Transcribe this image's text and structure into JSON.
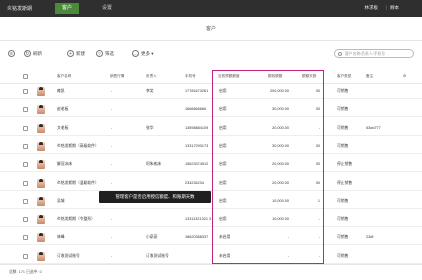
{
  "topbar": {
    "brand": "炎铭发斯期",
    "tabs": [
      {
        "label": "客户",
        "active": true
      },
      {
        "label": "设置",
        "active": false
      }
    ],
    "right_a": "林求板",
    "sep": "|",
    "right_b": "顾本"
  },
  "page": {
    "title": "客户"
  },
  "toolbar": {
    "refresh": "刷新",
    "add": "新建",
    "filter": "筛选",
    "more": "更多",
    "search_placeholder": "客户名称/负责人/手机号"
  },
  "columns": [
    "客户名称",
    "销售行情",
    "负责人",
    "手机号",
    "应收预额额度",
    "额收额额",
    "额额天数",
    "客户类型",
    "备注"
  ],
  "rows": [
    {
      "name": "雍凯",
      "sales": "-",
      "owner": "李笑",
      "phone": "17781673261",
      "status": "启用",
      "amount": "200,000.00",
      "days": "30",
      "type": "可销售",
      "note": ""
    },
    {
      "name": "赵老板",
      "sales": "-",
      "owner": "",
      "phone": "1666666666",
      "status": "启用",
      "amount": "30,000.00",
      "days": "30",
      "type": "可销售",
      "note": ""
    },
    {
      "name": "文老板",
      "sales": "-",
      "owner": "张华",
      "phone": "13598884109",
      "status": "启用",
      "amount": "20,000.00",
      "days": "-",
      "type": "可销售",
      "note": "53dd777"
    },
    {
      "name": "炎铭发斯期（高级软件）",
      "sales": "-",
      "owner": "",
      "phone": "13317293173",
      "status": "启用",
      "amount": "30,000.00",
      "days": "30",
      "type": "可销售",
      "note": ""
    },
    {
      "name": "解冠冰床",
      "sales": "-",
      "owner": "阿朱彬床",
      "phone": "15623374512",
      "status": "启用",
      "amount": "20,000.00",
      "days": "30",
      "type": "停止销售",
      "note": ""
    },
    {
      "name": "炎铭发斯期（温聪软件）",
      "sales": "-",
      "owner": "",
      "phone": "234234234",
      "status": "启用",
      "amount": "20,000.00",
      "days": "30",
      "type": "停止销售",
      "note": ""
    },
    {
      "name": "吴城",
      "sales": "-",
      "owner": "",
      "phone": "",
      "status": "启用",
      "amount": "10,000.00",
      "days": "1",
      "type": "可销售",
      "note": ""
    },
    {
      "name": "炎铭发斯期（令整形）",
      "sales": "-",
      "owner": "",
      "phone": "13311321321 3",
      "status": "启用",
      "amount": "10,000.00",
      "days": "-",
      "type": "可销售",
      "note": ""
    },
    {
      "name": "林峰",
      "sales": "-",
      "owner": "小豪豪",
      "phone": "18620368337",
      "status": "未启用",
      "amount": "-",
      "days": "-",
      "type": "可销售",
      "note": "23df"
    },
    {
      "name": "订收测试账号",
      "sales": "-",
      "owner": "订收测试账号",
      "phone": "",
      "status": "未启用",
      "amount": "-",
      "days": "-",
      "type": "可销售",
      "note": ""
    }
  ],
  "tooltip": "管理客户是否启用授信额度、和账期天数",
  "footer": {
    "info": "总数: 171  已选中: 0"
  }
}
